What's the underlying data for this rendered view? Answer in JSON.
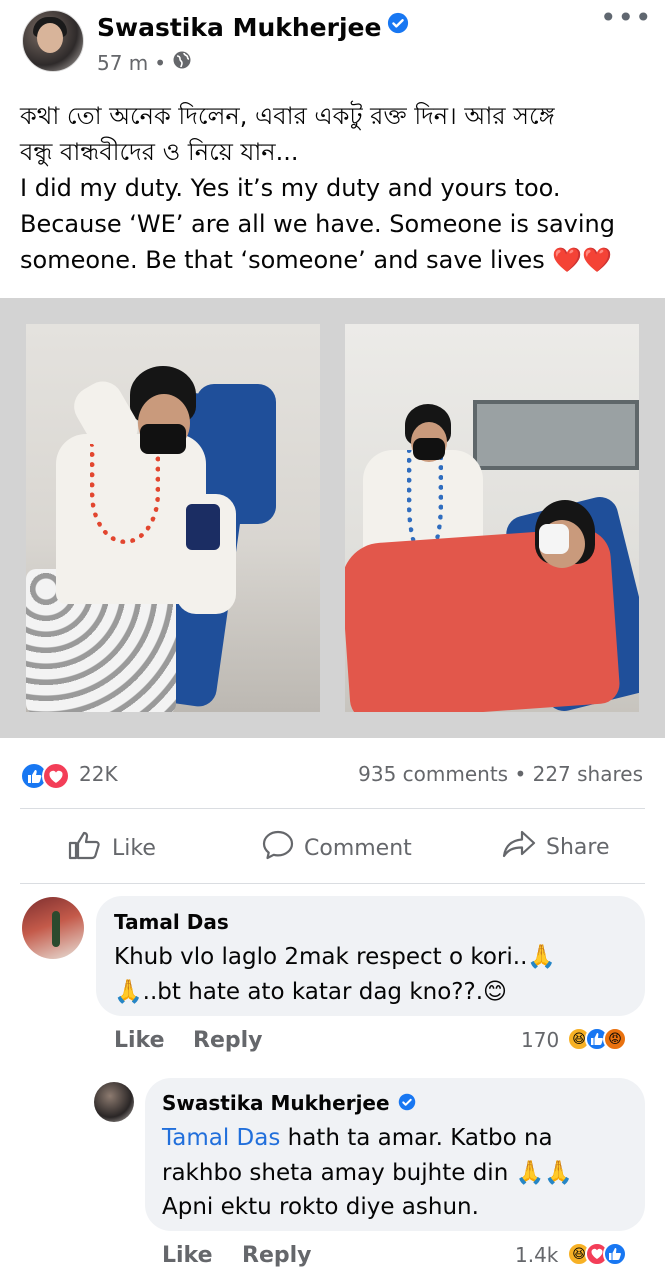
{
  "post": {
    "author": "Swastika Mukherjee",
    "time": "57 m",
    "separator": "•",
    "more": "•••",
    "text_lines": [
      "কথা তো অনেক দিলেন, এবার একটু রক্ত দিন। আর সঙ্গে",
      "বন্ধু বান্ধবীদের ও নিয়ে যান...",
      "I did my duty. Yes it’s my duty and yours too.",
      "Because ‘WE’ are all we have. Someone is saving",
      "someone. Be that ‘someone’ and save lives ❤️❤️"
    ]
  },
  "reactions": {
    "count": "22K",
    "stats": "935 comments • 227 shares"
  },
  "actions": {
    "like": "Like",
    "comment": "Comment",
    "share": "Share"
  },
  "comments": [
    {
      "name": "Tamal Das",
      "lines": [
        "Khub vlo laglo 2mak respect o kori..🙏",
        "🙏..bt hate ato katar dag kno??.😊"
      ],
      "like": "Like",
      "reply": "Reply",
      "count": "170"
    },
    {
      "name": "Swastika Mukherjee",
      "mention": "Tamal Das",
      "line1_rest": " hath ta amar. Katbo na",
      "line2": "rakhbo sheta amay bujhte din 🙏🙏",
      "line3": "Apni ektu rokto diye ashun.",
      "like": "Like",
      "reply": "Reply",
      "count": "1.4k"
    }
  ],
  "colors": {
    "like_blue": "#1877f2",
    "love_red": "#f33e58",
    "mention_blue": "#216fdb",
    "muted": "#65676b"
  }
}
